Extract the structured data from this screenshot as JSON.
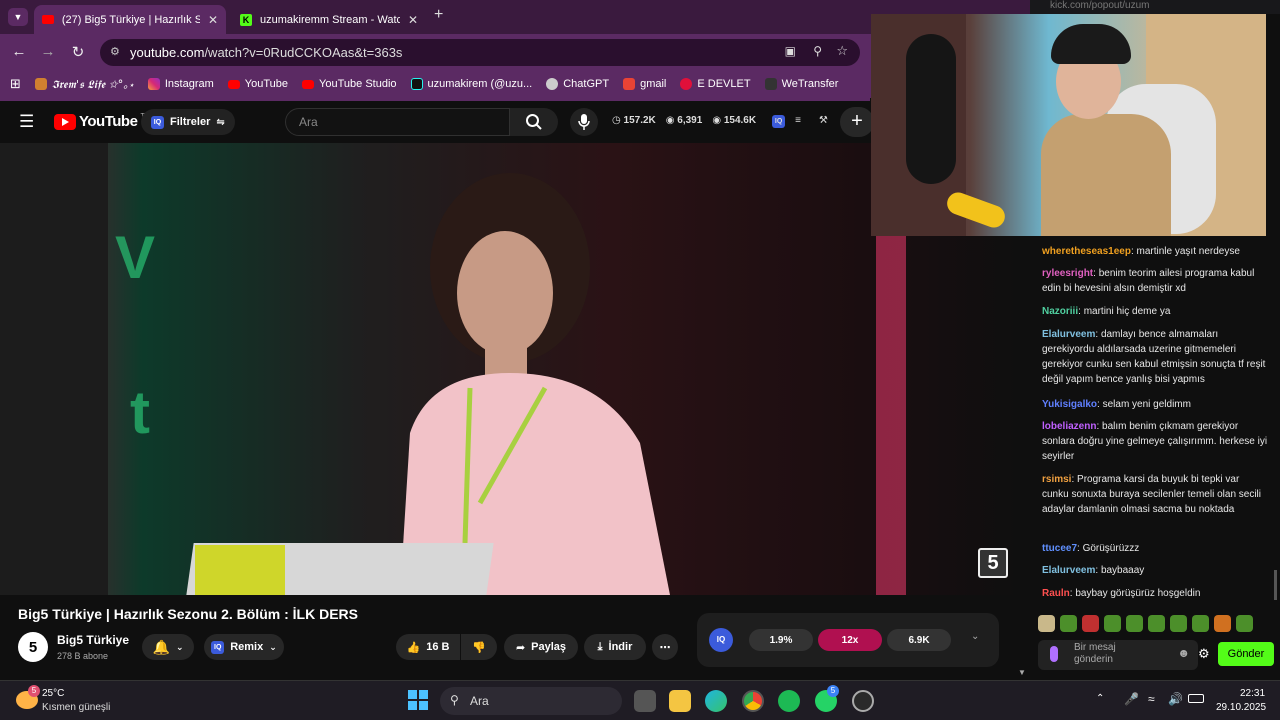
{
  "browser": {
    "tabs": [
      {
        "title": "(27) Big5 Türkiye | Hazırlık Sezo",
        "active": true
      },
      {
        "title": "uzumakiremm Stream - Watch",
        "active": false
      }
    ],
    "url_host": "youtube.com",
    "url_path": "/watch?v=0RudCCKOAas&t=363s",
    "bookmarks": [
      "𝕴𝖗𝖊𝖒'𝖘 𝕷𝖎𝖋𝖊 ✩°｡⋆",
      "Instagram",
      "YouTube",
      "YouTube Studio",
      "uzumakirem (@uzu...",
      "ChatGPT",
      "gmail",
      "E DEVLET",
      "WeTransfer"
    ],
    "right_tab_url": "kick.com/popout/uzum"
  },
  "youtube": {
    "logo_text": "YouTube",
    "logo_sup": "TR",
    "filters_label": "Filtreler",
    "search_placeholder": "Ara",
    "stats": {
      "views": "157.2K",
      "viewers": "6,391",
      "subs": "154.6K"
    },
    "video": {
      "title": "Big5 Türkiye | Hazırlık Sezonu 2. Bölüm : İLK DERS",
      "channel": "Big5 Türkiye",
      "subscribers": "278 B abone",
      "remix": "Remix",
      "likes": "16 B",
      "share": "Paylaş",
      "download": "İndir",
      "channel_logo": "5"
    },
    "iq_stats": [
      "1.9%",
      "12x",
      "6.9K"
    ]
  },
  "chat": {
    "messages": [
      {
        "user": "wheretheseas1eep",
        "color": "#f0a020",
        "text": "martinle yaşıt nerdeyse"
      },
      {
        "user": "ryleesright",
        "color": "#e060c0",
        "text": "benim teorim ailesi programa kabul edin bi hevesini alsın demiştir xd"
      },
      {
        "user": "Nazoriii",
        "color": "#50d0a0",
        "text": "martini hiç deme ya"
      },
      {
        "user": "Elalurveem",
        "color": "#80c0e0",
        "text": "damlayı bence almamaları gerekiyordu aldılarsada uzerine gitmemeleri gerekiyor cunku sen kabul etmişsin sonuçta tf reşit değil yapım bence yanlış bisi yapmıs"
      },
      {
        "user": "Yukisigalko",
        "color": "#6080ff",
        "text": "selam yeni geldimm"
      },
      {
        "user": "lobeliazenn",
        "color": "#c060ff",
        "text": "balım benim çıkmam gerekiyor sonlara doğru yine gelmeye çalışırımm. herkese iyi seyirler"
      },
      {
        "user": "rsimsi",
        "color": "#f0a040",
        "text": "Programa karsi da buyuk bi tepki var cunku sonuxta buraya secilenler temeli olan secili adaylar damlanin olmasi sacma bu noktada"
      },
      {
        "user": "ttucee7",
        "color": "#6090ff",
        "text": "Görüşürüzzz"
      },
      {
        "user": "Elalurveem",
        "color": "#80c0e0",
        "text": "baybaaay"
      },
      {
        "user": "Rauln",
        "color": "#ff5050",
        "text": "baybay görüşürüz hoşgeldin"
      }
    ],
    "input_placeholder": "Bir mesaj gönderin",
    "send_label": "Gönder"
  },
  "taskbar": {
    "weather_temp": "25°C",
    "weather_desc": "Kısmen güneşli",
    "weather_badge": "5",
    "search_label": "Ara",
    "whatsapp_badge": "5",
    "time": "22:31",
    "date": "29.10.2025"
  }
}
